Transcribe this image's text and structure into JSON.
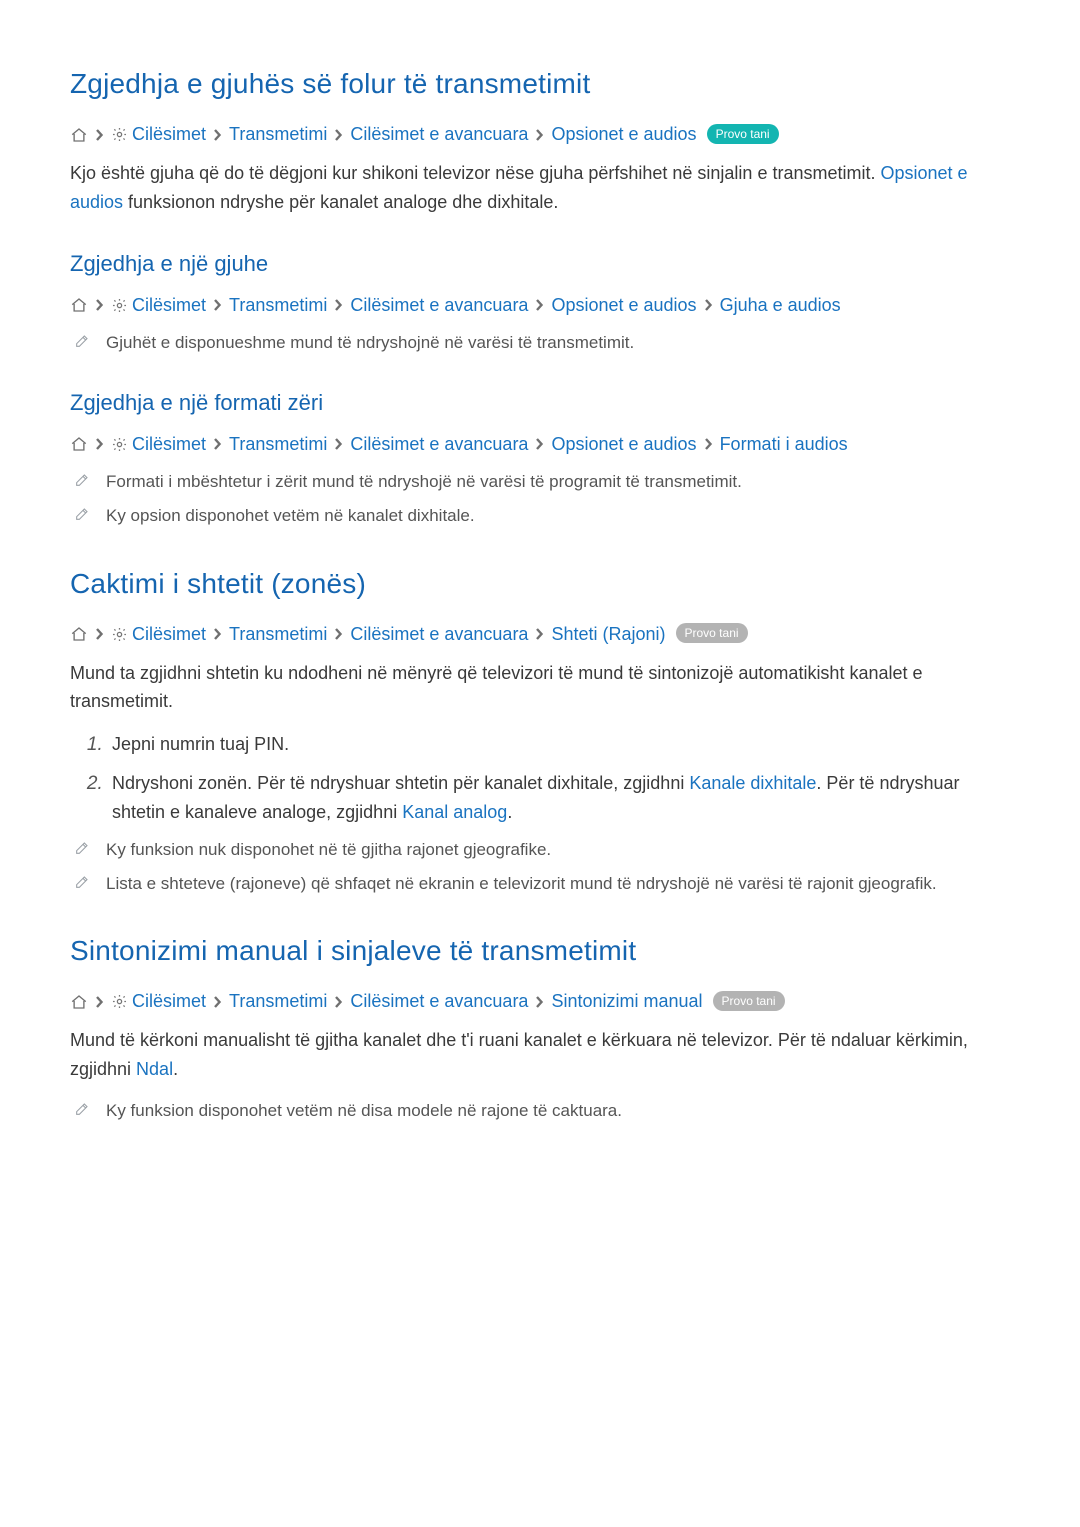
{
  "sections": [
    {
      "title": "Zgjedhja e gjuhës së folur të transmetimit",
      "path": {
        "items": [
          "Cilësimet",
          "Transmetimi",
          "Cilësimet e avancuara",
          "Opsionet e audios"
        ],
        "try_label": "Provo tani",
        "try_color": "teal"
      },
      "body_parts": [
        {
          "t": "plain",
          "v": "Kjo është gjuha që do të dëgjoni kur shikoni televizor nëse gjuha përfshihet në sinjalin e transmetimit. "
        },
        {
          "t": "link",
          "v": "Opsionet e audios"
        },
        {
          "t": "plain",
          "v": " funksionon ndryshe për kanalet analoge dhe dixhitale."
        }
      ],
      "subsections": [
        {
          "title": "Zgjedhja e një gjuhe",
          "path": {
            "items": [
              "Cilësimet",
              "Transmetimi",
              "Cilësimet e avancuara",
              "Opsionet e audios",
              "Gjuha e audios"
            ]
          },
          "notes": [
            "Gjuhët e disponueshme mund të ndryshojnë në varësi të transmetimit."
          ]
        },
        {
          "title": "Zgjedhja e një formati zëri",
          "path": {
            "items": [
              "Cilësimet",
              "Transmetimi",
              "Cilësimet e avancuara",
              "Opsionet e audios",
              "Formati i audios"
            ]
          },
          "notes": [
            "Formati i mbështetur i zërit mund të ndryshojë në varësi të programit të transmetimit.",
            "Ky opsion disponohet vetëm në kanalet dixhitale."
          ]
        }
      ]
    },
    {
      "title": "Caktimi i shtetit (zonës)",
      "path": {
        "items": [
          "Cilësimet",
          "Transmetimi",
          "Cilësimet e avancuara",
          "Shteti (Rajoni)"
        ],
        "try_label": "Provo tani",
        "try_color": "gray"
      },
      "body_parts": [
        {
          "t": "plain",
          "v": "Mund ta zgjidhni shtetin ku ndodheni në mënyrë që televizori të mund të sintonizojë automatikisht kanalet e transmetimit."
        }
      ],
      "steps": [
        [
          {
            "t": "plain",
            "v": "Jepni numrin tuaj PIN."
          }
        ],
        [
          {
            "t": "plain",
            "v": "Ndryshoni zonën. Për të ndryshuar shtetin për kanalet dixhitale, zgjidhni "
          },
          {
            "t": "link",
            "v": "Kanale dixhitale"
          },
          {
            "t": "plain",
            "v": ". Për të ndryshuar shtetin e kanaleve analoge, zgjidhni "
          },
          {
            "t": "link",
            "v": "Kanal analog"
          },
          {
            "t": "plain",
            "v": "."
          }
        ]
      ],
      "notes": [
        "Ky funksion nuk disponohet në të gjitha rajonet gjeografike.",
        "Lista e shteteve (rajoneve) që shfaqet në ekranin e televizorit mund të ndryshojë në varësi të rajonit gjeografik."
      ]
    },
    {
      "title": "Sintonizimi manual i sinjaleve të transmetimit",
      "path": {
        "items": [
          "Cilësimet",
          "Transmetimi",
          "Cilësimet e avancuara",
          "Sintonizimi manual"
        ],
        "try_label": "Provo tani",
        "try_color": "gray"
      },
      "body_parts": [
        {
          "t": "plain",
          "v": "Mund të kërkoni manualisht të gjitha kanalet dhe t'i ruani kanalet e kërkuara në televizor. Për të ndaluar kërkimin, zgjidhni "
        },
        {
          "t": "link",
          "v": "Ndal"
        },
        {
          "t": "plain",
          "v": "."
        }
      ],
      "notes": [
        "Ky funksion disponohet vetëm në disa modele në rajone të caktuara."
      ]
    }
  ]
}
